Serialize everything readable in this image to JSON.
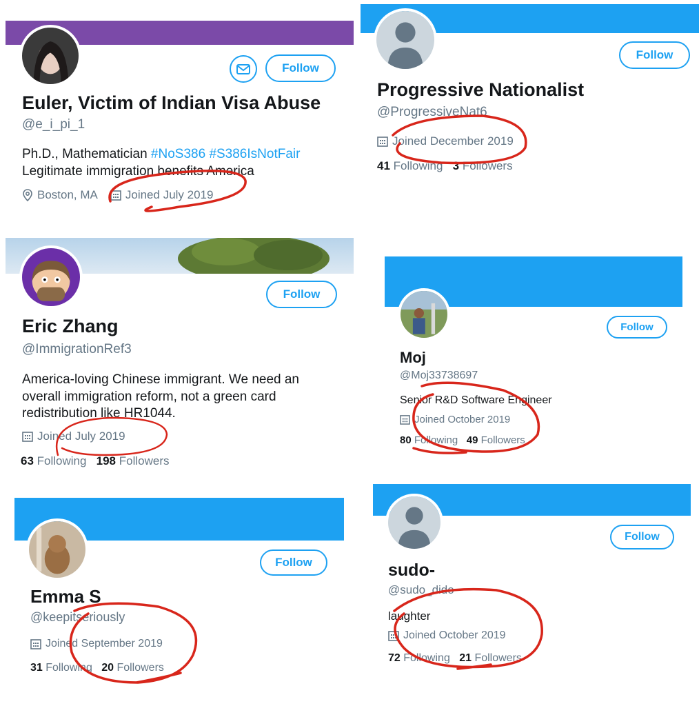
{
  "colors": {
    "twitter_blue": "#1da1f2",
    "purple_banner": "#7b4aa8",
    "annotation_red": "#d8261b",
    "muted": "#657786"
  },
  "cards": [
    {
      "name": "Euler, Victim of Indian Visa Abuse",
      "handle": "@e_i_pi_1",
      "bio_text": "Ph.D., Mathematician",
      "hashtag1": "#NoS386",
      "hashtag2": "#S386IsNotFair",
      "bio_line2": "Legitimate immigration benefits America",
      "location": "Boston, MA",
      "joined": "Joined July 2019",
      "follow": "Follow"
    },
    {
      "name": "Progressive Nationalist",
      "handle": "@ProgressiveNat6",
      "joined": "Joined December 2019",
      "following_count": "41",
      "following_label": "Following",
      "followers_count": "3",
      "followers_label": "Followers",
      "follow": "Follow"
    },
    {
      "name": "Eric Zhang",
      "handle": "@ImmigrationRef3",
      "bio": "America-loving Chinese immigrant. We need an overall immigration reform, not a green card redistribution like HR1044.",
      "joined": "Joined July 2019",
      "following_count": "63",
      "following_label": "Following",
      "followers_count": "198",
      "followers_label": "Followers",
      "follow": "Follow"
    },
    {
      "name": "Moj",
      "handle": "@Moj33738697",
      "bio": "Senior R&D Software Engineer",
      "joined": "Joined October 2019",
      "following_count": "80",
      "following_label": "Following",
      "followers_count": "49",
      "followers_label": "Followers",
      "follow": "Follow"
    },
    {
      "name": "Emma S",
      "handle": "@keepitseriously",
      "joined": "Joined September 2019",
      "following_count": "31",
      "following_label": "Following",
      "followers_count": "20",
      "followers_label": "Followers",
      "follow": "Follow"
    },
    {
      "name": "sudo-",
      "handle": "@sudo_dido",
      "bio": "laughter",
      "joined": "Joined October 2019",
      "following_count": "72",
      "following_label": "Following",
      "followers_count": "21",
      "followers_label": "Followers",
      "follow": "Follow"
    }
  ],
  "icons": {
    "calendar": "calendar-icon",
    "location": "location-pin-icon",
    "message": "envelope-icon"
  }
}
